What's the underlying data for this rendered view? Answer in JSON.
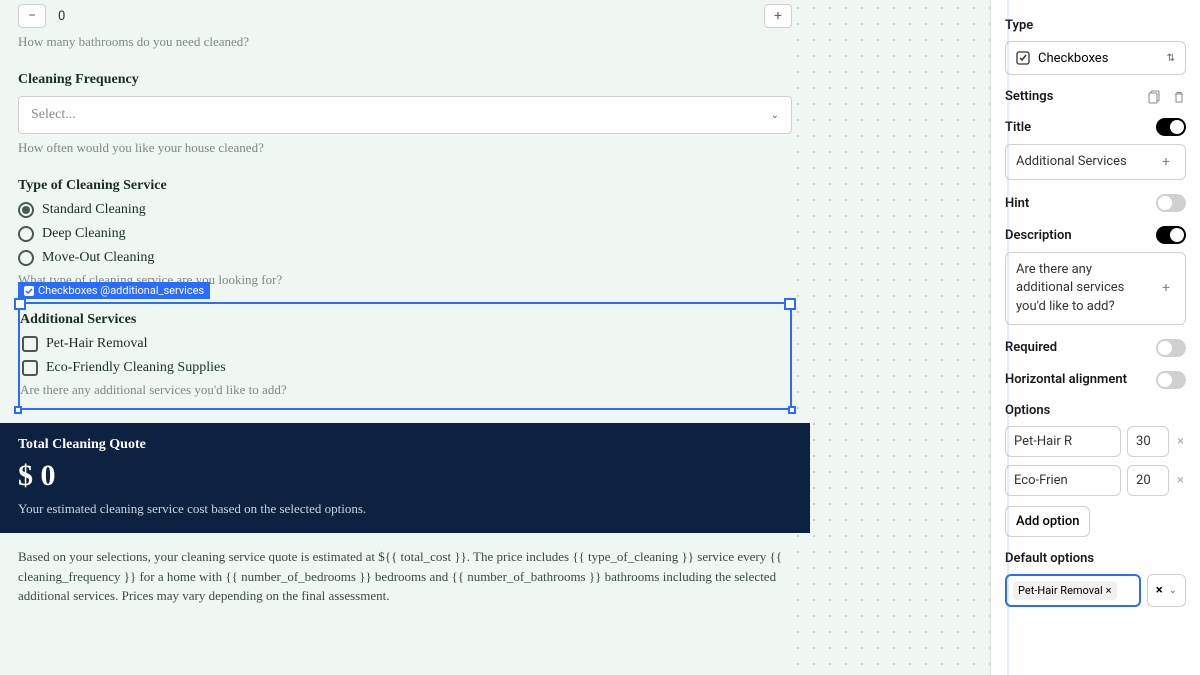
{
  "bathrooms": {
    "value": "0",
    "help": "How many bathrooms do you need cleaned?"
  },
  "frequency": {
    "label": "Cleaning Frequency",
    "placeholder": "Select...",
    "help": "How often would you like your house cleaned?"
  },
  "cleaning_type": {
    "label": "Type of Cleaning Service",
    "options": [
      "Standard Cleaning",
      "Deep Cleaning",
      "Move-Out Cleaning"
    ],
    "help": "What type of cleaning service are you looking for?"
  },
  "additional": {
    "tag": "Checkboxes @additional_services",
    "label": "Additional Services",
    "options": [
      "Pet-Hair Removal",
      "Eco-Friendly Cleaning Supplies"
    ],
    "help": "Are there any additional services you'd like to add?"
  },
  "quote": {
    "title": "Total Cleaning Quote",
    "amount": "$ 0",
    "desc": "Your estimated cleaning service cost based on the selected options."
  },
  "summary": "Based on your selections, your cleaning service quote is estimated at ${{ total_cost }}. The price includes {{ type_of_cleaning }} service every {{ cleaning_frequency }} for a home with {{ number_of_bedrooms }} bedrooms and {{ number_of_bathrooms }} bathrooms including the selected additional services. Prices may vary depending on the final assessment.",
  "panel": {
    "type_label": "Type",
    "type_value": "Checkboxes",
    "settings_label": "Settings",
    "title_label": "Title",
    "title_value": "Additional Services",
    "hint_label": "Hint",
    "desc_label": "Description",
    "desc_value": "Are there any additional services you'd like to add?",
    "required_label": "Required",
    "horiz_label": "Horizontal alignment",
    "options_label": "Options",
    "options": [
      {
        "name": "Pet-Hair R",
        "val": "30"
      },
      {
        "name": "Eco-Frien",
        "val": "20"
      }
    ],
    "add_option": "Add option",
    "default_label": "Default options",
    "default_chip": "Pet-Hair Removal"
  }
}
